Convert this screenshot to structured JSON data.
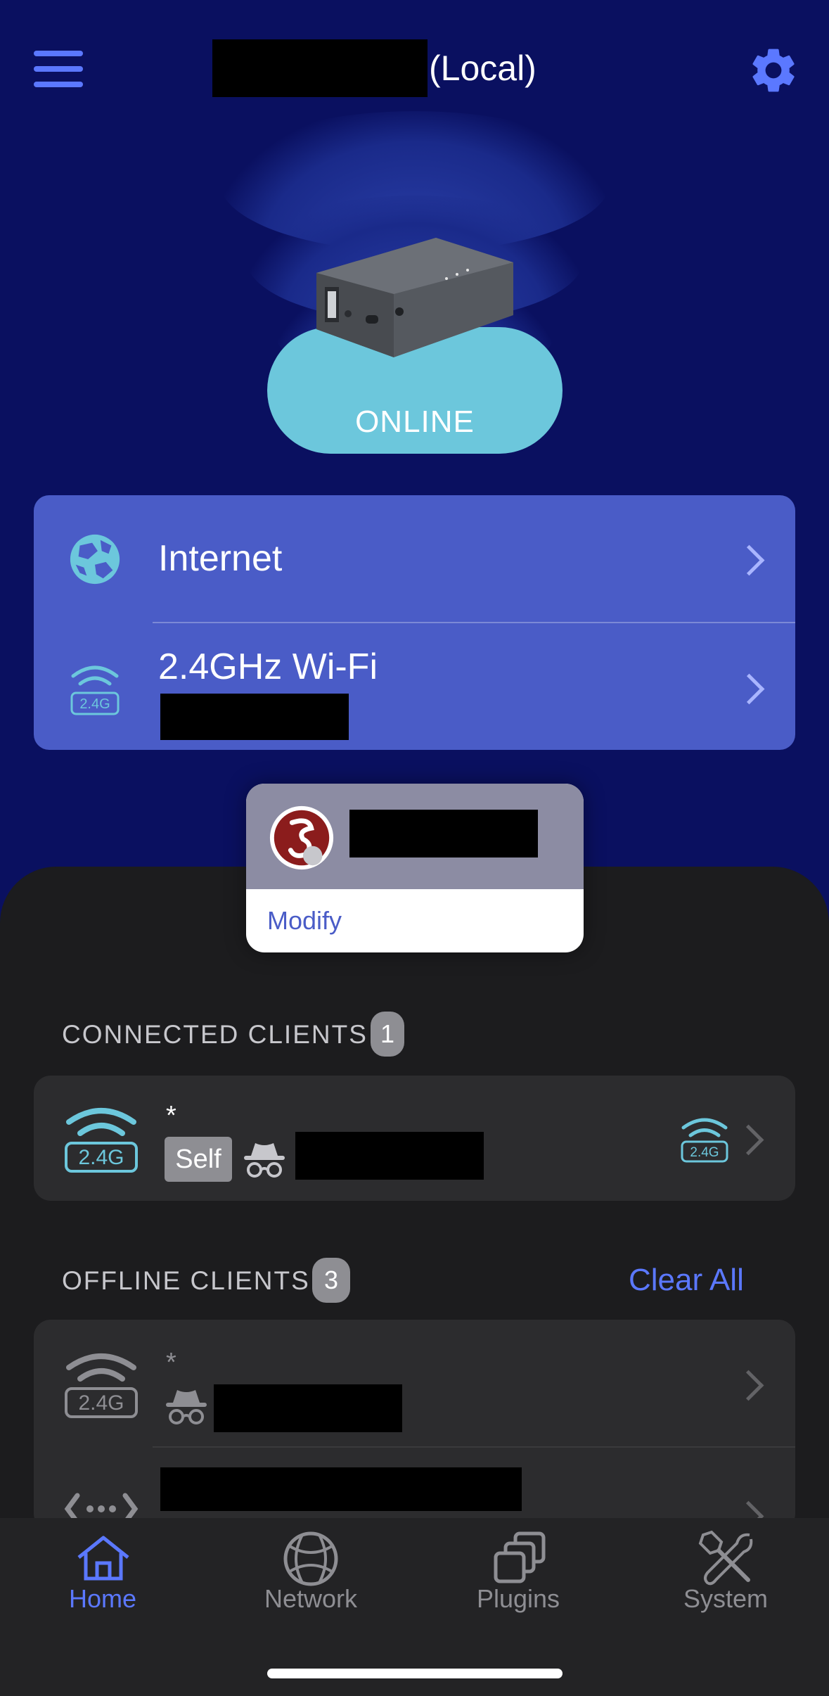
{
  "header": {
    "device_suffix": "(Local)"
  },
  "hero": {
    "status": "ONLINE"
  },
  "top_card": {
    "internet_label": "Internet",
    "wifi_label": "2.4GHz Wi-Fi",
    "wifi_band_badge": "2.4G"
  },
  "popup": {
    "action": "Modify"
  },
  "connected": {
    "title": "CONNECTED CLIENTS",
    "count": "1",
    "client": {
      "name": "*",
      "band": "2.4G",
      "self_label": "Self"
    }
  },
  "offline": {
    "title": "OFFLINE CLIENTS",
    "count": "3",
    "clear_label": "Clear All",
    "clients": [
      {
        "name": "*",
        "band": "2.4G"
      }
    ]
  },
  "tabs": [
    {
      "label": "Home",
      "icon": "home-icon",
      "active": true
    },
    {
      "label": "Network",
      "icon": "globe-icon",
      "active": false
    },
    {
      "label": "Plugins",
      "icon": "plugins-icon",
      "active": false
    },
    {
      "label": "System",
      "icon": "tools-icon",
      "active": false
    }
  ],
  "colors": {
    "background": "#0a1060",
    "accent": "#5b78ff",
    "card": "#4a5cc7",
    "online": "#6cc7dc",
    "sheet": "#1c1c1e"
  }
}
